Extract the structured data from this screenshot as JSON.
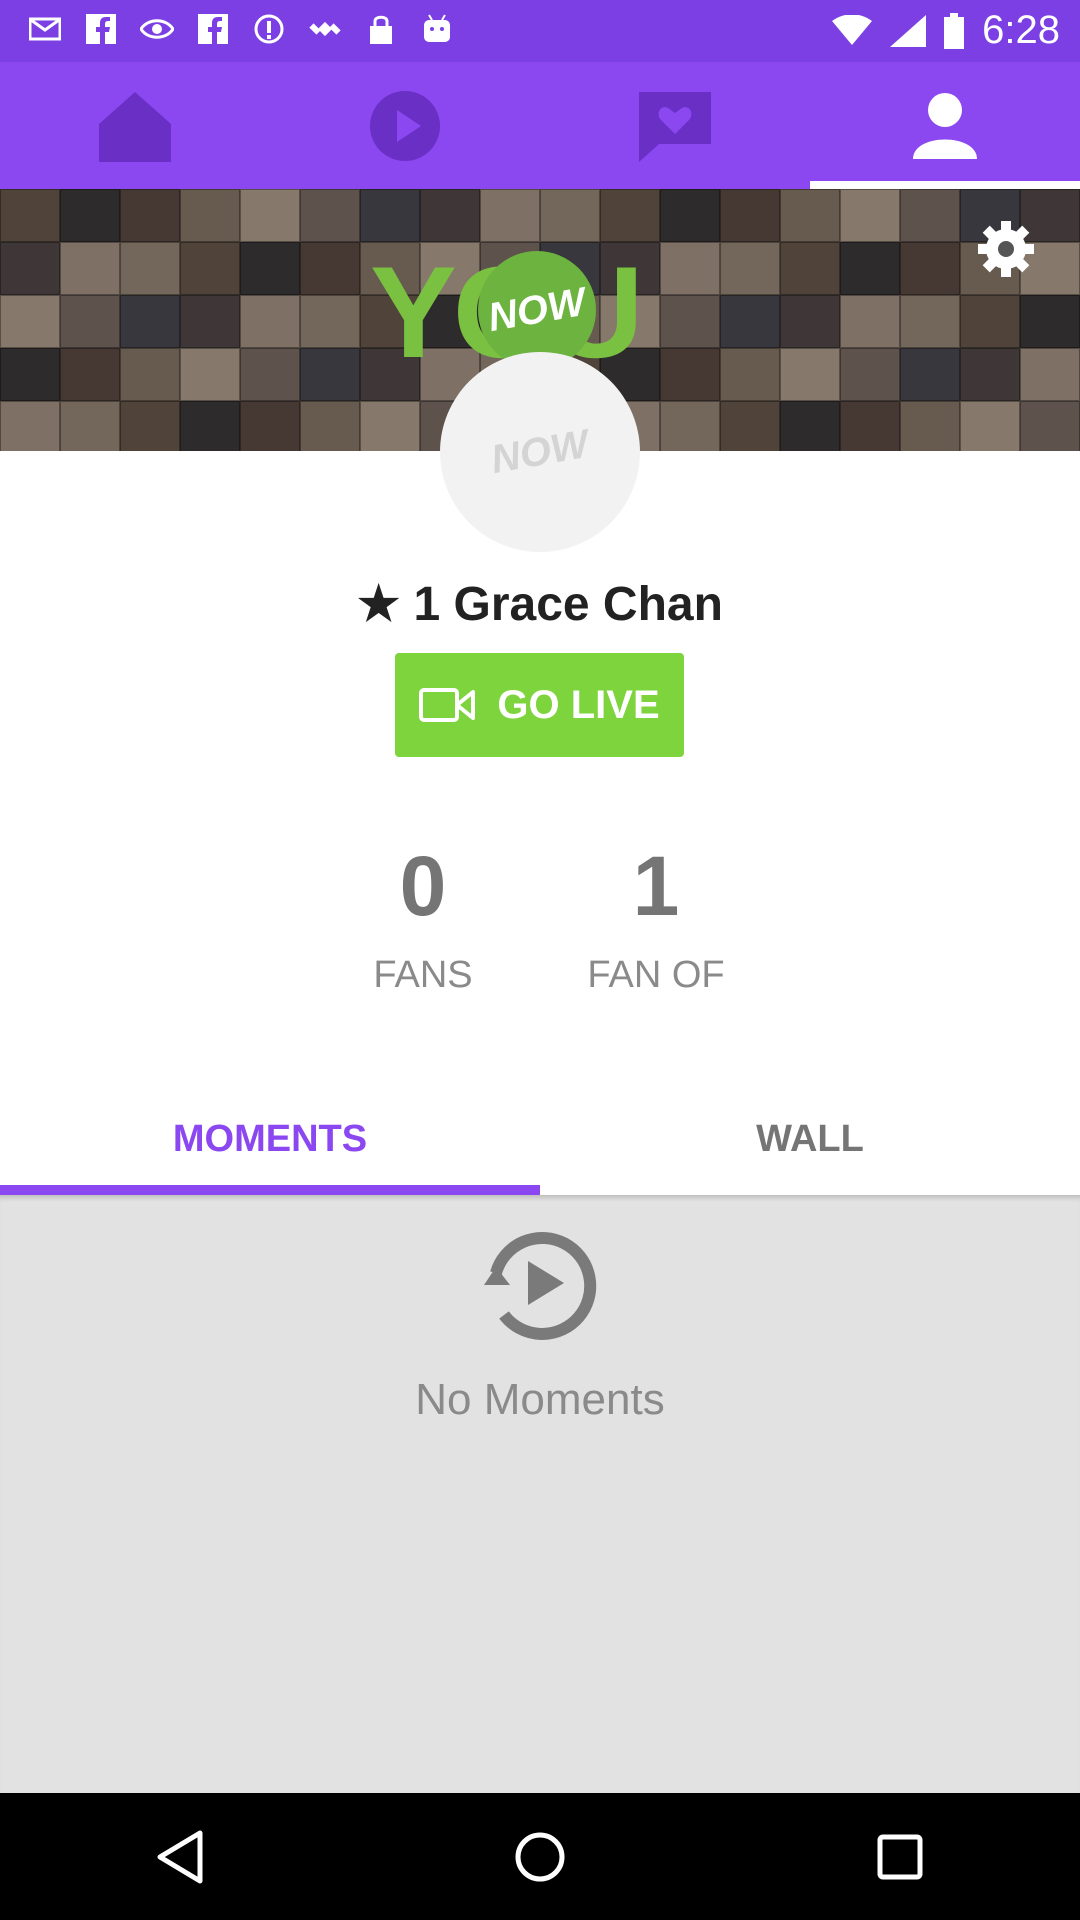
{
  "status_bar": {
    "time": "6:28",
    "icons": [
      "mail-icon",
      "facebook-icon",
      "eye-icon",
      "facebook-icon",
      "info-icon",
      "fake-gps-icon",
      "lock-icon",
      "android-icon"
    ]
  },
  "top_nav": {
    "tabs": [
      {
        "icon": "home-icon",
        "active": false
      },
      {
        "icon": "play-icon",
        "active": false
      },
      {
        "icon": "chat-heart-icon",
        "active": false
      },
      {
        "icon": "profile-icon",
        "active": true
      }
    ]
  },
  "banner": {
    "logo_you": "YOU",
    "logo_now": "NOW"
  },
  "profile": {
    "avatar_text": "NOW",
    "star": "★",
    "name": "1 Grace Chan",
    "go_live_label": "GO LIVE"
  },
  "stats": {
    "fans_count": "0",
    "fans_label": "FANS",
    "fan_of_count": "1",
    "fan_of_label": "FAN OF"
  },
  "tabs": {
    "moments_label": "MOMENTS",
    "wall_label": "WALL",
    "active": "MOMENTS"
  },
  "moments": {
    "empty_text": "No Moments"
  },
  "colors": {
    "primary": "#8b48f0",
    "status_bar": "#7b3fe4",
    "go_live": "#7dd43c",
    "content_bg": "#e2e2e2"
  }
}
